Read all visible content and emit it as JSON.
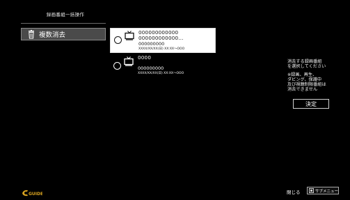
{
  "menu": {
    "title": "録画番組一括操作",
    "items": [
      {
        "label": "複数消去",
        "icon": "delete-trash-icon"
      }
    ]
  },
  "recordings": [
    {
      "title_line1": "000000000000",
      "title_line2": "000000000000…",
      "subtitle": "000000000",
      "datetime": "XXXX/XX/XX(日) XX:XX〜OOO",
      "selected": true
    },
    {
      "title_line1": "0000",
      "subtitle": "000000000",
      "datetime": "XXXX/XX/XX(日) XX:XX〜OOO",
      "selected": false
    }
  ],
  "info_panel": {
    "instruction_line1": "消去する録画番組",
    "instruction_line2": "を選択してください",
    "note_line1": "※録画、再生、",
    "note_line2": "ダビング、保護中",
    "note_line3": "及び視聴制限番組は",
    "note_line4": "消去できません",
    "confirm_label": "決定"
  },
  "footer": {
    "logo_text": "G GUIDE",
    "close_label": "閉じる",
    "submenu_label": "サブメニュー"
  },
  "colors": {
    "background": "#000000",
    "selected_row": "#ffffff",
    "side_item": "#4a4a4a",
    "logo": "#d9a320"
  }
}
